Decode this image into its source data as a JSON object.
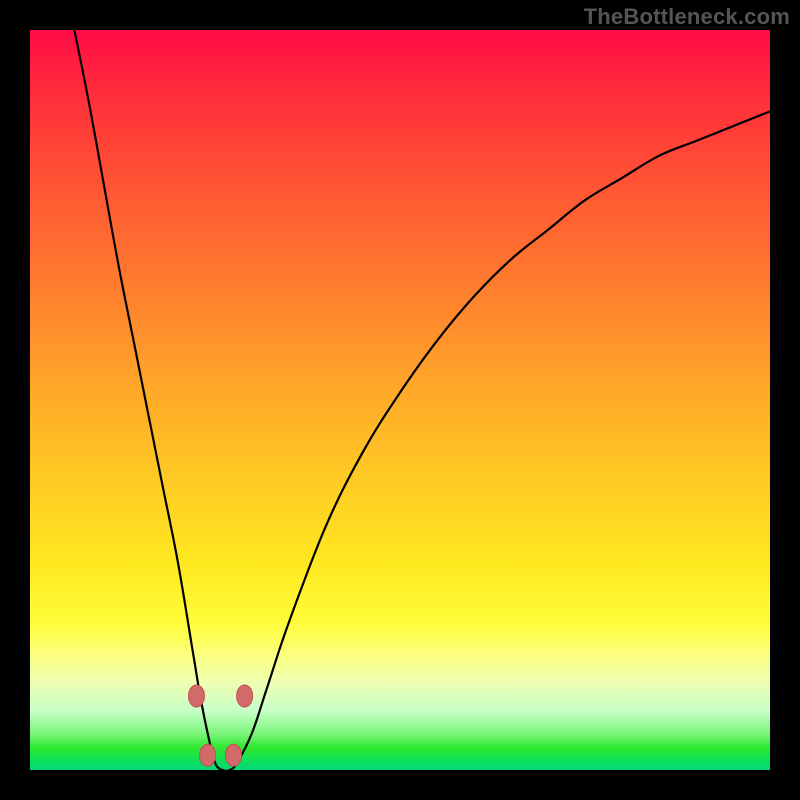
{
  "watermark": "TheBottleneck.com",
  "chart_data": {
    "type": "line",
    "title": "",
    "xlabel": "",
    "ylabel": "",
    "xlim": [
      0,
      100
    ],
    "ylim": [
      0,
      100
    ],
    "grid": false,
    "legend": false,
    "background_gradient": {
      "direction": "top-to-bottom",
      "stops": [
        {
          "pos": 0,
          "color": "#ff0b45"
        },
        {
          "pos": 22,
          "color": "#ff5833"
        },
        {
          "pos": 48,
          "color": "#ffa629"
        },
        {
          "pos": 72,
          "color": "#ffe820"
        },
        {
          "pos": 88,
          "color": "#f0ffb0"
        },
        {
          "pos": 100,
          "color": "#06d878"
        }
      ]
    },
    "series": [
      {
        "name": "bottleneck-curve",
        "color": "#000000",
        "x": [
          6,
          8,
          10,
          12,
          14,
          16,
          18,
          20,
          22,
          23,
          24,
          25,
          26,
          27,
          28,
          30,
          32,
          35,
          40,
          45,
          50,
          55,
          60,
          65,
          70,
          75,
          80,
          85,
          90,
          95,
          100
        ],
        "y": [
          100,
          90,
          79,
          68,
          58,
          48,
          38,
          28,
          16,
          10,
          5,
          1,
          0,
          0,
          1,
          5,
          11,
          20,
          33,
          43,
          51,
          58,
          64,
          69,
          73,
          77,
          80,
          83,
          85,
          87,
          89
        ]
      }
    ],
    "markers": [
      {
        "x": 22.5,
        "y": 10
      },
      {
        "x": 24.0,
        "y": 2
      },
      {
        "x": 27.5,
        "y": 2
      },
      {
        "x": 29.0,
        "y": 10
      }
    ]
  }
}
